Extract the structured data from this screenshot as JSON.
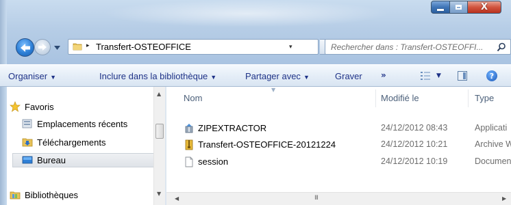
{
  "window": {
    "buttons": {
      "minimize_icon": "minimize-icon",
      "maximize_icon": "maximize-icon",
      "close_symbol": "X"
    }
  },
  "address_bar": {
    "separator": "▸",
    "path": "Transfert-OSTEOFFICE",
    "dropdown": "▾"
  },
  "search": {
    "placeholder": "Rechercher dans : Transfert-OSTEOFFI..."
  },
  "toolbar": {
    "organise": "Organiser",
    "include": "Inclure dans la bibliothèque",
    "share": "Partager avec",
    "burn": "Graver",
    "more": "»",
    "help": "?"
  },
  "nav_pane": {
    "favorites": "Favoris",
    "items": [
      "Emplacements récents",
      "Téléchargements",
      "Bureau"
    ],
    "libraries": "Bibliothèques"
  },
  "file_list": {
    "columns": {
      "name": "Nom",
      "modified": "Modifié le",
      "type": "Type"
    },
    "rows": [
      {
        "name": "ZIPEXTRACTOR",
        "modified": "24/12/2012 08:43",
        "type": "Applicati"
      },
      {
        "name": "Transfert-OSTEOFFICE-20121224",
        "modified": "24/12/2012 10:21",
        "type": "Archive W"
      },
      {
        "name": "session",
        "modified": "24/12/2012 10:19",
        "type": "Documen"
      }
    ]
  },
  "scrollbar": {
    "grip": "III"
  },
  "colors": {
    "chrome": "#b6cde6",
    "command_text": "#1e3287",
    "close_red": "#d1553f"
  }
}
